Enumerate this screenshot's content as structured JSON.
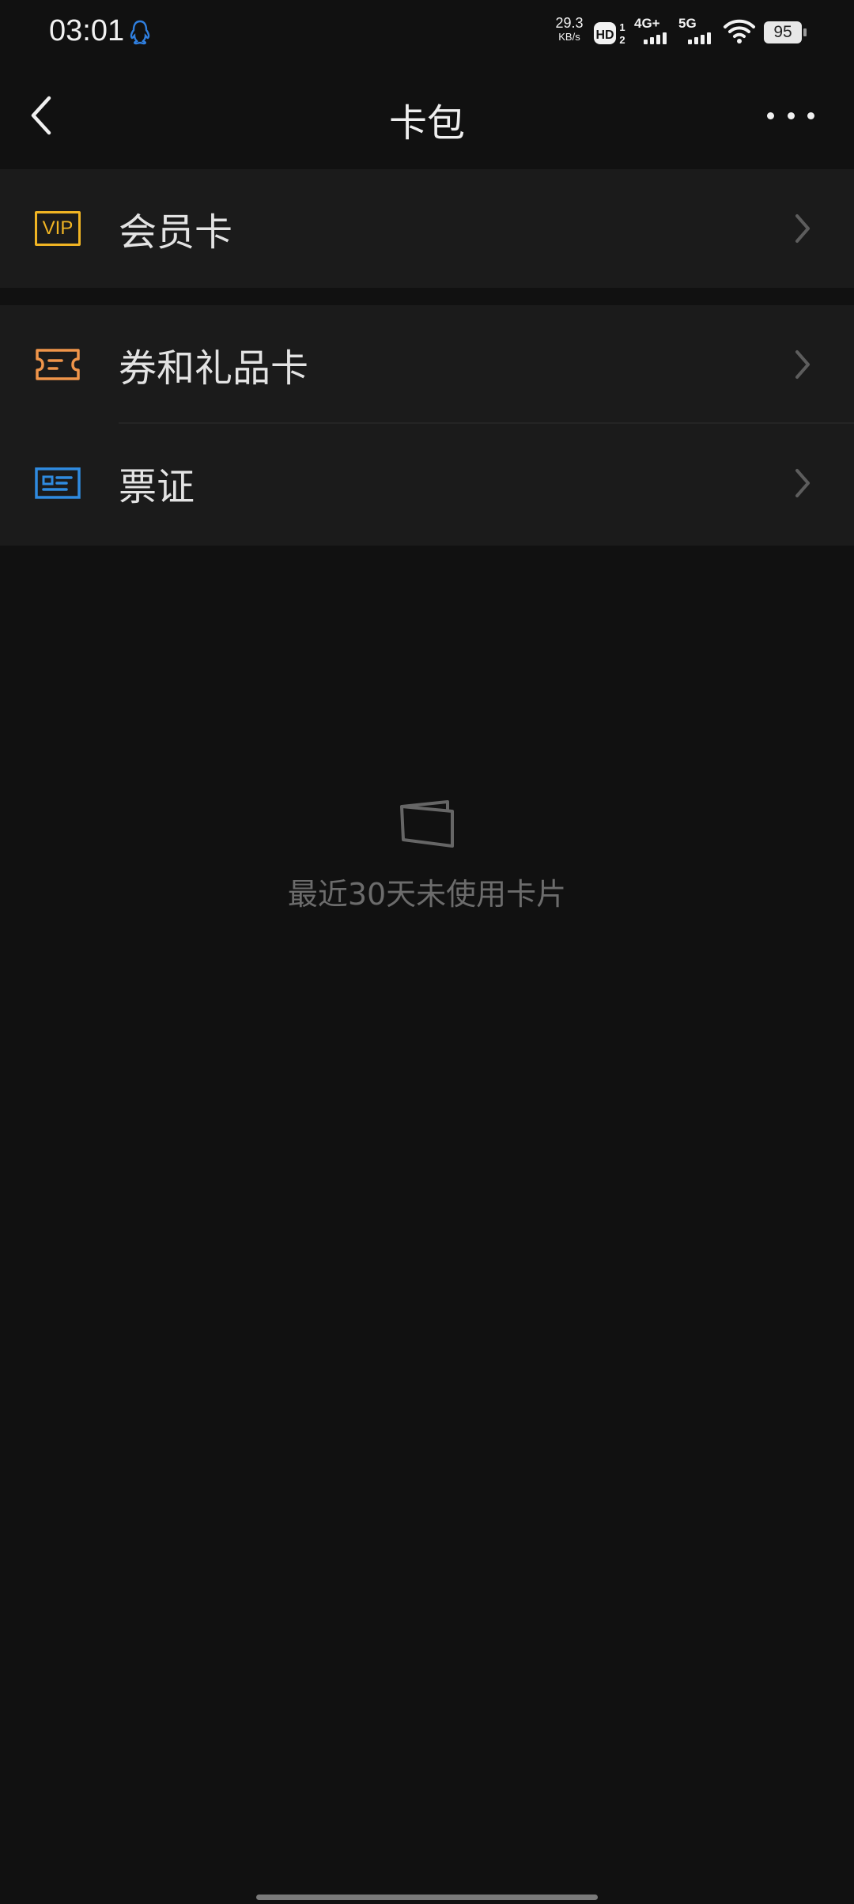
{
  "status_bar": {
    "time": "03:01",
    "net_speed_value": "29.3",
    "net_speed_unit": "KB/s",
    "hd_label": "HD",
    "hd_sim_top": "1",
    "hd_sim_bottom": "2",
    "sim1_label": "4G+",
    "sim2_label": "5G",
    "battery_level": "95",
    "icons": [
      "qq-penguin-icon",
      "hd-voice-icon",
      "signal-icon",
      "wifi-icon",
      "battery-icon"
    ]
  },
  "header": {
    "title": "卡包",
    "back_icon": "chevron-left-icon",
    "more_icon": "more-dots-icon"
  },
  "sections": [
    {
      "items": [
        {
          "label": "会员卡",
          "icon": "vip-card-icon",
          "icon_text": "VIP",
          "icon_color": "#f0b423"
        }
      ]
    },
    {
      "items": [
        {
          "label": "券和礼品卡",
          "icon": "coupon-ticket-icon",
          "icon_color": "#f0954a"
        },
        {
          "label": "票证",
          "icon": "id-card-icon",
          "icon_color": "#2f8be0"
        }
      ]
    }
  ],
  "empty_state": {
    "icon": "card-wallet-icon",
    "text": "最近30天未使用卡片"
  },
  "colors": {
    "background": "#111111",
    "row_background": "#1b1b1b",
    "muted_text": "#6c6c6c"
  }
}
